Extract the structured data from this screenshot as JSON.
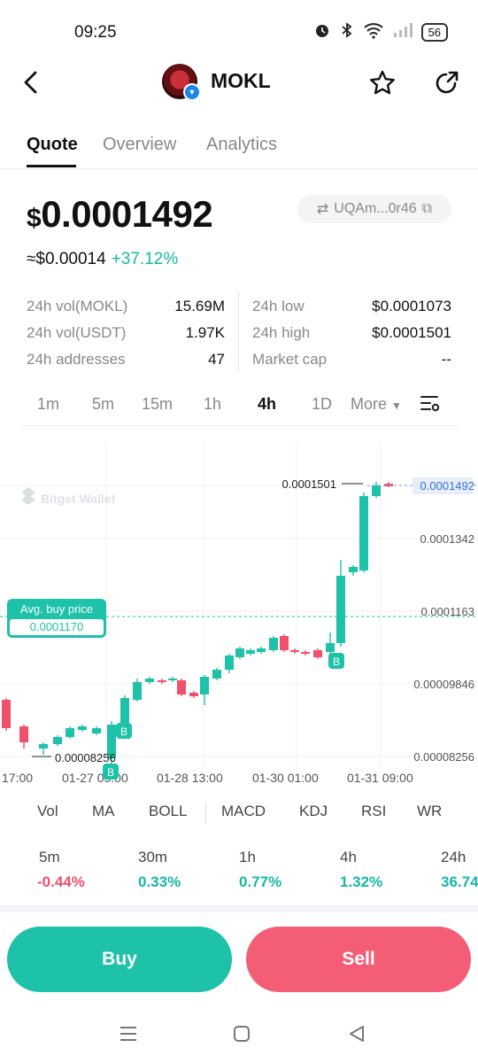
{
  "status_bar": {
    "time": "09:25",
    "battery": "56"
  },
  "header": {
    "title": "MOKL"
  },
  "tabs": [
    "Quote",
    "Overview",
    "Analytics"
  ],
  "price": {
    "currency_symbol": "$",
    "value": "0.0001492",
    "approx": "≈$0.00014",
    "change": "+37.12%",
    "address": "UQAm...0r46"
  },
  "stats_left": [
    {
      "label": "24h vol(MOKL)",
      "value": "15.69M"
    },
    {
      "label": "24h vol(USDT)",
      "value": "1.97K"
    },
    {
      "label": "24h addresses",
      "value": "47"
    }
  ],
  "stats_right": [
    {
      "label": "24h low",
      "value": "$0.0001073"
    },
    {
      "label": "24h high",
      "value": "$0.0001501"
    },
    {
      "label": "Market cap",
      "value": "--"
    }
  ],
  "timeframes": [
    "1m",
    "5m",
    "15m",
    "1h",
    "4h",
    "1D",
    "More"
  ],
  "active_timeframe": "4h",
  "chart_data": {
    "type": "candlestick",
    "watermark": "Bitget Wallet",
    "y_ticks": [
      "0.0001492",
      "0.0001342",
      "0.0001163",
      "0.00009846",
      "0.00008256"
    ],
    "x_ticks": [
      "17:00",
      "01-27 05:00",
      "01-28 13:00",
      "01-30 01:00",
      "01-31 09:00"
    ],
    "high_label": "0.0001501",
    "low_label": "0.00008256",
    "avg_buy_label": "Avg. buy price",
    "avg_buy_value": "0.0001170",
    "current_price": "0.0001492",
    "marker": "B",
    "colors": {
      "up": "#1dc2a8",
      "down": "#f0506a"
    }
  },
  "indicators": [
    "Vol",
    "MA",
    "BOLL",
    "MACD",
    "KDJ",
    "RSI",
    "WR"
  ],
  "price_changes": [
    {
      "period": "5m",
      "value": "-0.44%",
      "dir": "down"
    },
    {
      "period": "30m",
      "value": "0.33%",
      "dir": "up"
    },
    {
      "period": "1h",
      "value": "0.77%",
      "dir": "up"
    },
    {
      "period": "4h",
      "value": "1.32%",
      "dir": "up"
    },
    {
      "period": "24h",
      "value": "36.74",
      "dir": "up"
    }
  ],
  "actions": {
    "buy": "Buy",
    "sell": "Sell"
  }
}
